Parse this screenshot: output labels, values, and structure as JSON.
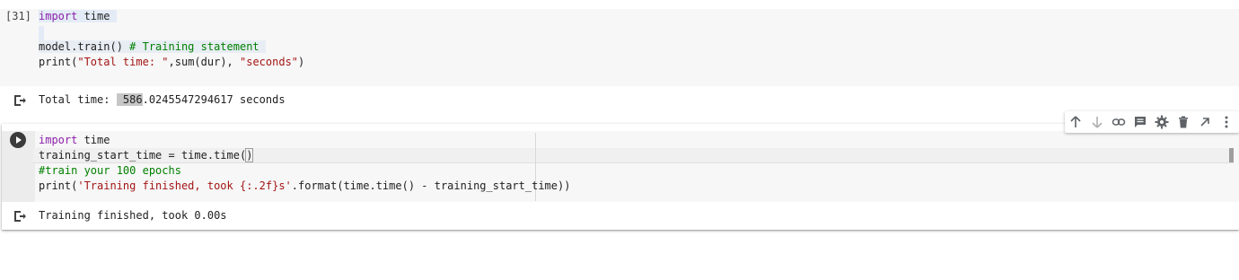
{
  "cell1": {
    "exec_count": "[31]",
    "line1_kw": "import",
    "line1_rest": " time",
    "line3_code": "model.train() ",
    "line3_comment": "# Training statement",
    "line4_a": "print(",
    "line4_str1": "\"Total time: \"",
    "line4_b": ",sum(dur), ",
    "line4_str2": "\"seconds\"",
    "line4_c": ")"
  },
  "output1": {
    "prefix": "Total time: ",
    "selected": " 586",
    "suffix": ".0245547294617 seconds"
  },
  "cell2": {
    "line1_kw": "import",
    "line1_rest": " time",
    "line2_a": "training_start_time = time.time(",
    "line2_b": ")",
    "line3_comment": "#train your 100 epochs",
    "line4_a": "print(",
    "line4_str": "'Training finished, took {:.2f}s'",
    "line4_b": ".format(time.time() - training_start_time)",
    "line4_c": ")"
  },
  "output2": {
    "text": "Training finished, took 0.00s"
  },
  "toolbar": {
    "icons": [
      "arrow-up-icon",
      "arrow-down-icon",
      "link-icon",
      "comment-icon",
      "gear-icon",
      "trash-icon",
      "expand-icon",
      "more-vert-icon"
    ]
  },
  "colors": {
    "keyword": "#8b1fa9",
    "string": "#a31515",
    "comment": "#008000",
    "cell_bg": "#f7f7f7"
  }
}
